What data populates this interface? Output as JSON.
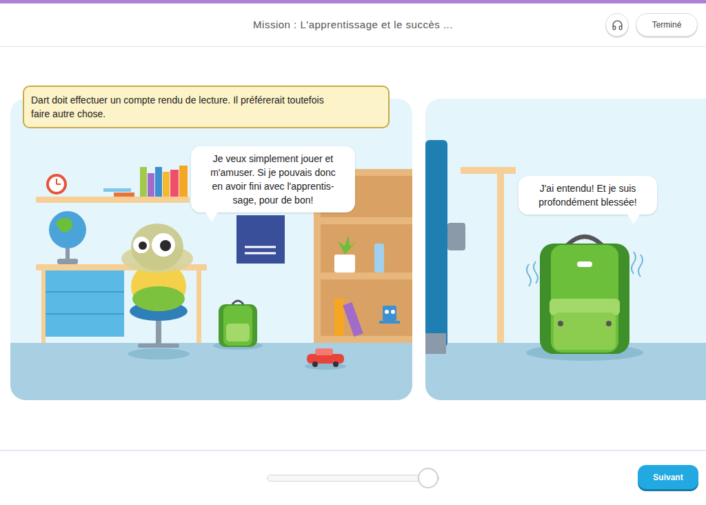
{
  "header": {
    "title": "Mission : L'apprentissage et le succès ...",
    "done_button": "Terminé"
  },
  "panels": [
    {
      "caption": [
        "Dart doit effectuer un compte rendu de lecture. Il préférerait toutefois",
        "faire autre chose."
      ],
      "bubble": [
        "Je veux simplement jouer et",
        "m'amuser. Si je pouvais donc",
        "en avoir fini avec l'apprentis-",
        "sage, pour de bon!"
      ]
    },
    {
      "caption": [],
      "bubble": [
        "J'ai entendu! Et je suis",
        "profondément blessée!"
      ]
    }
  ],
  "progress": {
    "level": 0.94
  },
  "next_button": "Suivant"
}
